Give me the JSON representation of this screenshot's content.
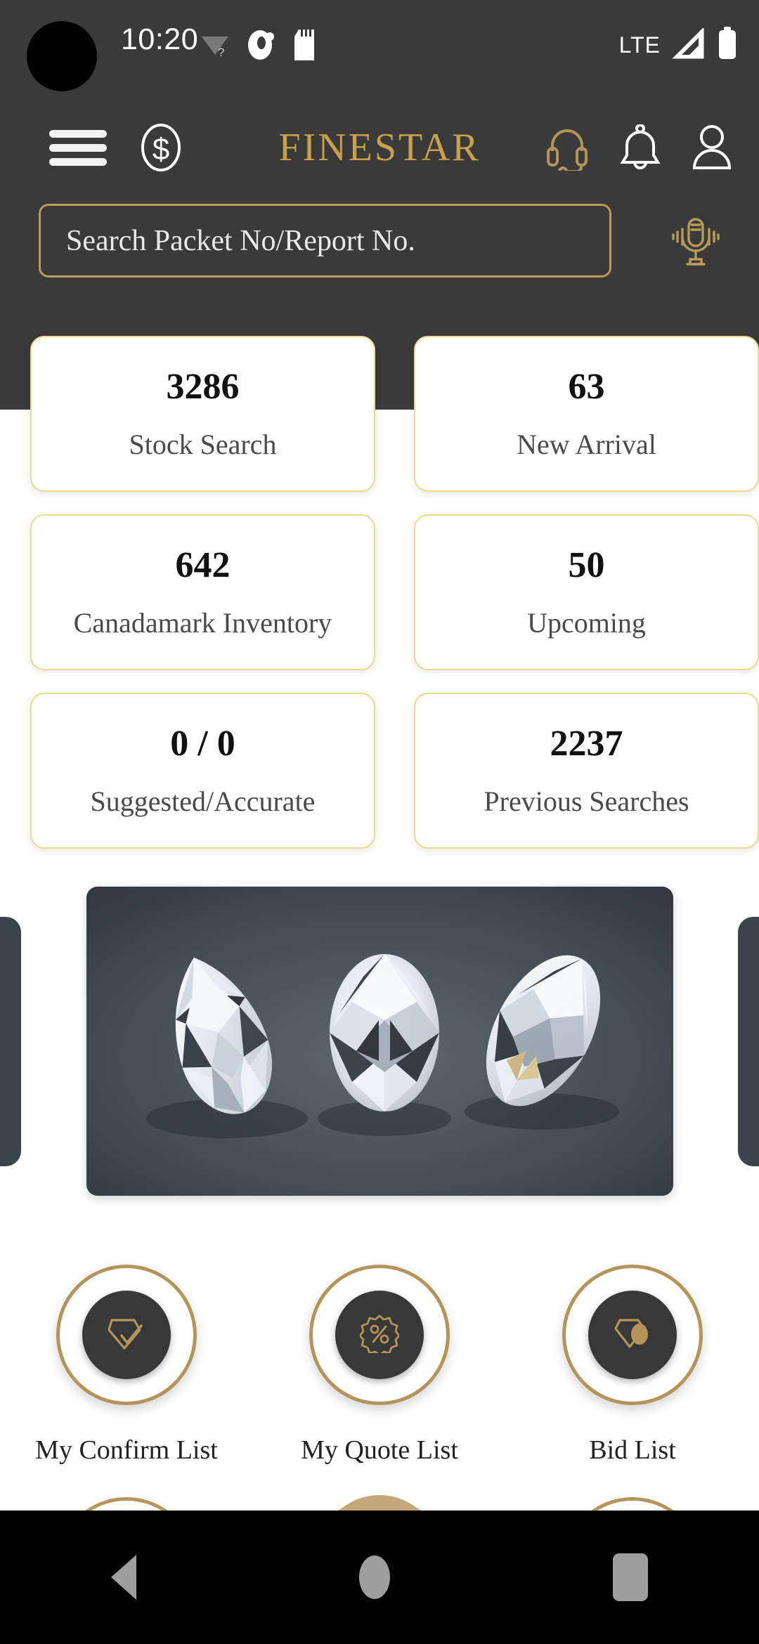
{
  "status_bar": {
    "time": "10:20",
    "network_label": "LTE",
    "icons": [
      "wifi-question-icon",
      "app-indicator-icon",
      "sd-card-icon",
      "signal-icon",
      "battery-icon"
    ]
  },
  "app_bar": {
    "brand": "FINESTAR",
    "menu_icon": "hamburger-menu-icon",
    "currency_icon": "dollar-coin-icon",
    "support_icon": "headset-icon",
    "notification_icon": "bell-icon",
    "profile_icon": "user-icon",
    "brand_color": "#c9a14a"
  },
  "search": {
    "placeholder": "Search Packet No/Report No.",
    "value": "",
    "voice_icon": "microphone-icon",
    "border_color": "#b99a58"
  },
  "stats": [
    {
      "value": "3286",
      "label": "Stock Search"
    },
    {
      "value": "63",
      "label": "New Arrival"
    },
    {
      "value": "642",
      "label": "Canadamark Inventory"
    },
    {
      "value": "50",
      "label": "Upcoming"
    },
    {
      "value": "0 / 0",
      "label": "Suggested/Accurate"
    },
    {
      "value": "2237",
      "label": "Previous Searches"
    }
  ],
  "banner": {
    "alt": "three-loose-diamonds-pear-oval-marquise",
    "background_color": "#3b4449"
  },
  "quick_actions": [
    {
      "label": "My Confirm List",
      "icon": "diamond-check-icon"
    },
    {
      "label": "My Quote List",
      "icon": "percent-badge-icon"
    },
    {
      "label": "Bid List",
      "icon": "diamond-gavel-icon"
    }
  ],
  "expand_button": {
    "icon": "chevron-down-icon",
    "color": "#c4a87a"
  },
  "navigation_bar": {
    "back": "back-nav-button",
    "home": "home-nav-button",
    "recents": "recents-nav-button"
  },
  "theme": {
    "header_bg": "#3a3a3a",
    "card_border": "#e6dd88",
    "gold": "#b5945a"
  }
}
